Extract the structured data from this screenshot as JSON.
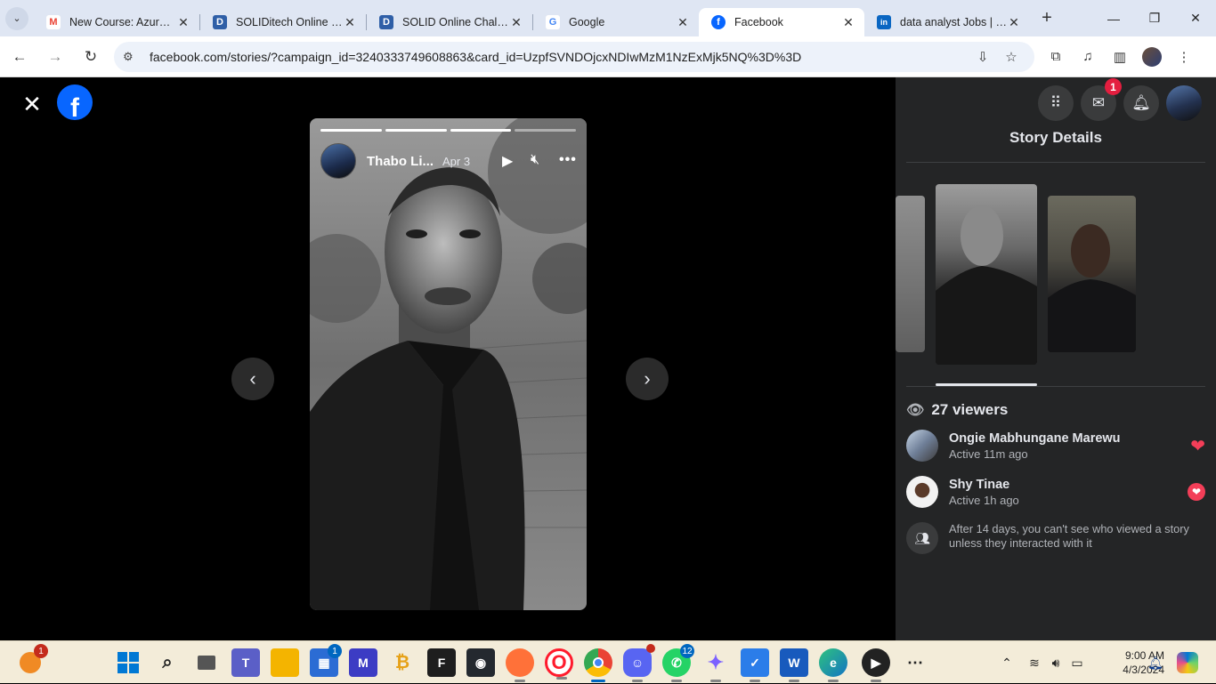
{
  "browser": {
    "tabs": [
      {
        "title": "New Course: Azure M",
        "favicon": "gmail-icon",
        "color": "#ea4335",
        "glyph": "M"
      },
      {
        "title": "SOLIDitech Online JA",
        "favicon": "doc-icon",
        "color": "#2f5fa7",
        "glyph": "D"
      },
      {
        "title": "SOLID Online Challen",
        "favicon": "doc-icon",
        "color": "#2f5fa7",
        "glyph": "D"
      },
      {
        "title": "Google",
        "favicon": "google-icon",
        "color": "#4285f4",
        "glyph": "G"
      },
      {
        "title": "Facebook",
        "favicon": "facebook-icon",
        "color": "#0866ff",
        "glyph": "f",
        "active": true
      },
      {
        "title": "data analyst Jobs | Lin",
        "favicon": "linkedin-icon",
        "color": "#0a66c2",
        "glyph": "in"
      }
    ],
    "close_glyph": "✕",
    "new_tab_glyph": "+",
    "url": "facebook.com/stories/?campaign_id=3240333749608863&card_id=UzpfSVNDOjcxNDIwMzM1NzExMjk5NQ%3D%3D"
  },
  "story": {
    "author": "Thabo Li...",
    "date": "Apr 3",
    "progress": [
      1,
      1,
      1,
      0.0
    ]
  },
  "panel": {
    "messenger_badge": "1",
    "title": "Story Details",
    "viewers_count": "27 viewers",
    "viewers": [
      {
        "name": "Ongie Mabhungane Marewu",
        "status": "Active 11m ago",
        "reaction": "heart"
      },
      {
        "name": "Shy Tinae",
        "status": "Active 1h ago",
        "reaction": "heart"
      }
    ],
    "note": "After 14 days, you can't see who viewed a story unless they interacted with it"
  },
  "taskbar": {
    "weather_badge": "1",
    "store_badge": "1",
    "whatsapp_badge": "12",
    "time": "9:00 AM",
    "date": "4/3/2024"
  },
  "colors": {
    "facebook_blue": "#0866ff",
    "panel_bg": "#242526",
    "heart": "#f33e58",
    "badge_red": "#e41e3f"
  }
}
